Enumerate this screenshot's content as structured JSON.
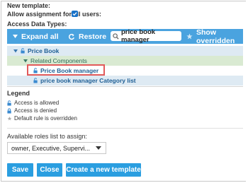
{
  "header": {
    "new_template_label": "New template:",
    "allow_assignment_label": "Allow assignment for all users:",
    "allow_assignment_checked": true,
    "access_data_types_label": "Access Data Types:"
  },
  "toolbar": {
    "expand_all_label": "Expand all",
    "restore_label": "Restore",
    "search_value": "price book manager",
    "show_overridden_label": "Show overridden",
    "background_color": "#4aa3df"
  },
  "tree": {
    "items": [
      {
        "label": "Price Book",
        "level": 1
      },
      {
        "label": "Related Components",
        "level": 2
      },
      {
        "label": "Price Book manager",
        "level": 3,
        "highlighted": true
      },
      {
        "label": "price book manager Category list",
        "level": 3
      }
    ]
  },
  "legend": {
    "title": "Legend",
    "items": [
      {
        "label": "Access is allowed",
        "icon": "lock-open-icon"
      },
      {
        "label": "Access is denied",
        "icon": "lock-closed-icon"
      },
      {
        "label": "Default rule is overridden",
        "icon": "overridden-icon"
      }
    ]
  },
  "roles": {
    "label": "Available roles list to assign:",
    "selected_value": "owner, Executive, Supervi..."
  },
  "buttons": {
    "save_label": "Save",
    "close_label": "Close",
    "create_label": "Create a new template"
  },
  "colors": {
    "accent": "#2a9ee0",
    "highlight_border": "#e25a5a"
  }
}
